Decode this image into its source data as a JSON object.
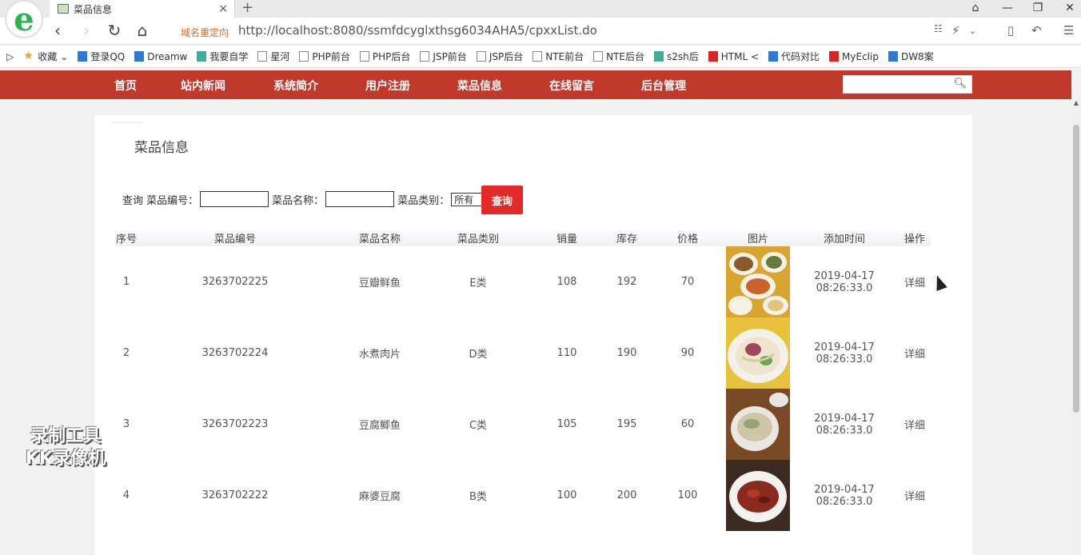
{
  "browser": {
    "tab_title": "菜品信息",
    "tab_close": "×",
    "new_tab": "+",
    "window_controls": [
      "⌂",
      "—",
      "❐",
      "✕"
    ],
    "redirect_label": "域名重定向",
    "url": "http://localhost:8080/ssmfdcyglxthsg6034AHA5/cpxxList.do",
    "bookmarks": [
      {
        "icon": "star-icon",
        "label": "收藏"
      },
      {
        "icon": "qq-icon",
        "label": "登录QQ"
      },
      {
        "icon": "dreamweaver-icon",
        "label": "Dreamw"
      },
      {
        "icon": "check-icon",
        "label": "我要自学"
      },
      {
        "icon": "page-icon",
        "label": "星河"
      },
      {
        "icon": "page-icon",
        "label": "PHP前台"
      },
      {
        "icon": "page-icon",
        "label": "PHP后台"
      },
      {
        "icon": "page-icon",
        "label": "JSP前台"
      },
      {
        "icon": "page-icon",
        "label": "JSP后台"
      },
      {
        "icon": "page-icon",
        "label": "NTE前台"
      },
      {
        "icon": "page-icon",
        "label": "NTE后台"
      },
      {
        "icon": "image-icon",
        "label": "s2sh后"
      },
      {
        "icon": "html-icon",
        "label": "HTML <"
      },
      {
        "icon": "compare-icon",
        "label": "代码对比"
      },
      {
        "icon": "myeclipse-icon",
        "label": "MyEclip"
      },
      {
        "icon": "paw-icon",
        "label": "DW8案"
      }
    ]
  },
  "nav": {
    "items": [
      "首页",
      "站内新闻",
      "系统简介",
      "用户注册",
      "菜品信息",
      "在线留言",
      "后台管理"
    ],
    "search_placeholder": ""
  },
  "page": {
    "title": "菜品信息",
    "query": {
      "label": "查询",
      "code_label": "菜品编号：",
      "name_label": "菜品名称：",
      "type_label": "菜品类别：",
      "type_value": "所有",
      "button": "查询"
    },
    "table": {
      "headers": [
        "序号",
        "菜品编号",
        "菜品名称",
        "菜品类别",
        "销量",
        "库存",
        "价格",
        "图片",
        "添加时间",
        "操作"
      ],
      "rows": [
        {
          "no": "1",
          "code": "3263702225",
          "name": "豆瓣鲜鱼",
          "type": "E类",
          "sales": "108",
          "stock": "192",
          "price": "70",
          "time": "2019-04-17 08:26:33.0",
          "action": "详细"
        },
        {
          "no": "2",
          "code": "3263702224",
          "name": "水煮肉片",
          "type": "D类",
          "sales": "110",
          "stock": "190",
          "price": "90",
          "time": "2019-04-17 08:26:33.0",
          "action": "详细"
        },
        {
          "no": "3",
          "code": "3263702223",
          "name": "豆腐鲫鱼",
          "type": "C类",
          "sales": "105",
          "stock": "195",
          "price": "60",
          "time": "2019-04-17 08:26:33.0",
          "action": "详细"
        },
        {
          "no": "4",
          "code": "3263702222",
          "name": "麻婆豆腐",
          "type": "B类",
          "sales": "100",
          "stock": "200",
          "price": "100",
          "time": "2019-04-17 08:26:33.0",
          "action": "详细"
        }
      ]
    }
  },
  "watermark": {
    "line1": "录制工具",
    "line2": "KK录像机"
  },
  "colors": {
    "nav_bg": "#c0392b",
    "button_bg": "#e22a2a",
    "brand_green": "#2db34a"
  }
}
